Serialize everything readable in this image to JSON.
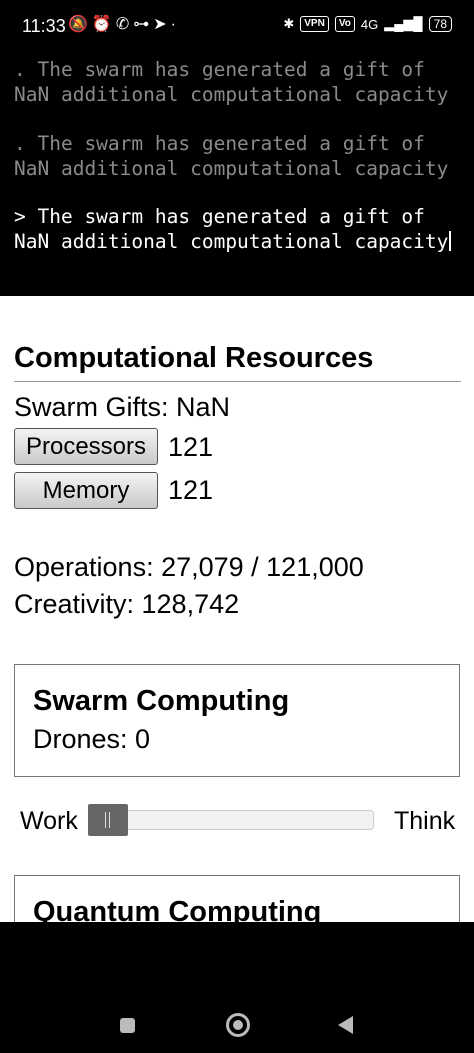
{
  "status_bar": {
    "time": "11:33",
    "left_icons": "🔕⏰✆⊶➤·",
    "bluetooth": "✱",
    "vpn": "VPN",
    "volte": "Vo",
    "network": "4G",
    "signal": "▂▄▆█",
    "battery": "78"
  },
  "console": {
    "lines": [
      ". The swarm has generated a gift of NaN additional computational capacity",
      ". The swarm has generated a gift of NaN additional computational capacity",
      "> The swarm has generated a gift of NaN additional computational capacity"
    ]
  },
  "resources": {
    "title": "Computational Resources",
    "swarm_gifts": "Swarm Gifts: NaN",
    "processors_label": "Processors",
    "processors_value": "121",
    "memory_label": "Memory",
    "memory_value": "121",
    "operations": "Operations: 27,079 / 121,000",
    "creativity": "Creativity: 128,742"
  },
  "swarm": {
    "title": "Swarm Computing",
    "drones": "Drones: 0",
    "slider_left": "Work",
    "slider_right": "Think",
    "slider_value": 0
  },
  "quantum": {
    "title": "Quantum Computing"
  }
}
